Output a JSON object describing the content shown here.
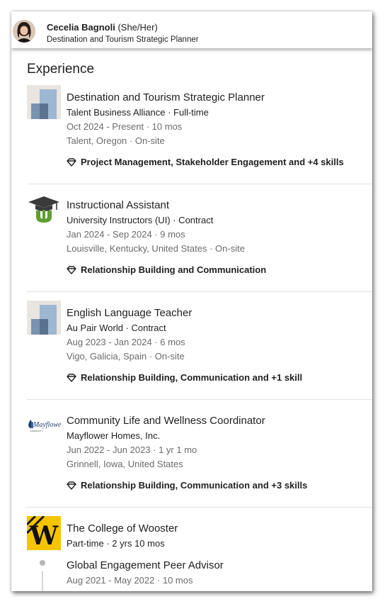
{
  "header": {
    "name": "Cecelia Bagnoli",
    "pronouns": "(She/Her)",
    "headline": "Destination and Tourism Strategic Planner"
  },
  "experience": {
    "title": "Experience",
    "entries": [
      {
        "title": "Destination and Tourism Strategic Planner",
        "subtitle": "Talent Business Alliance · Full-time",
        "dates": "Oct 2024 - Present · 10 mos",
        "location": "Talent, Oregon · On-site",
        "skills": "Project Management, Stakeholder Engagement and +4 skills",
        "logo": "generic-company-logo"
      },
      {
        "title": "Instructional Assistant",
        "subtitle": "University Instructors (UI) · Contract",
        "dates": "Jan 2024 - Sep 2024 · 9 mos",
        "location": "Louisville, Kentucky, United States · On-site",
        "skills": "Relationship Building and Communication",
        "logo": "graduation-cap-logo"
      },
      {
        "title": "English Language Teacher",
        "subtitle": "Au Pair World · Contract",
        "dates": "Aug 2023 - Jan 2024 · 6 mos",
        "location": "Vigo, Galicia, Spain · On-site",
        "skills": "Relationship Building, Communication and +1 skill",
        "logo": "generic-company-logo"
      },
      {
        "title": "Community Life and Wellness Coordinator",
        "subtitle": "Mayflower Homes, Inc.",
        "dates": "Jun 2022 - Jun 2023 · 1 yr 1 mo",
        "location": "Grinnell, Iowa, United States",
        "skills": "Relationship Building, Communication and +3 skills",
        "logo": "mayflower-logo",
        "logo_text": "Mayflower",
        "logo_subtext": "COMMUNITY"
      }
    ],
    "group": {
      "company": "The College of Wooster",
      "subtitle": "Part-time · 2 yrs 10 mos",
      "logo": "wooster-w-logo",
      "logo_letter": "W",
      "role": {
        "title": "Global Engagement Peer Advisor",
        "dates": "Aug 2021 - May 2022 · 10 mos"
      }
    }
  },
  "colors": {
    "accent_green": "#5e9e2f",
    "wooster_gold": "#f5c400",
    "text_secondary": "#6b6b6b"
  }
}
